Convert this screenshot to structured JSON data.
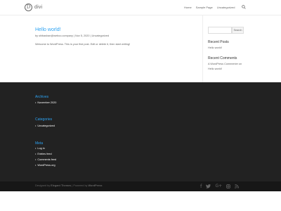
{
  "header": {
    "logo_mark": "D",
    "logo_text": "divi",
    "nav": [
      "Home",
      "Sample Page",
      "Uncategorized"
    ]
  },
  "post": {
    "title": "Hello world!",
    "meta_by": "by",
    "author": "shibashan@weboo.company",
    "separator": "|",
    "date": "Nov 5, 2020",
    "category": "Uncategorized",
    "body": "Welcome to WordPress. This is your first post. Edit or delete it, then start writing!"
  },
  "sidebar": {
    "search_button": "Search",
    "recent_posts_title": "Recent Posts",
    "recent_posts": [
      "Hello world!"
    ],
    "recent_comments_title": "Recent Comments",
    "recent_comment_line1": "A WordPress Commenter on",
    "recent_comment_line2": "Hello world!"
  },
  "footer": {
    "archives_title": "Archives",
    "archives": [
      "November 2020"
    ],
    "categories_title": "Categories",
    "categories": [
      "Uncategorized"
    ],
    "meta_title": "Meta",
    "meta": [
      "Log in",
      "Entries feed",
      "Comments feed",
      "WordPress.org"
    ]
  },
  "bottom": {
    "designed_by": "Designed by",
    "theme_name": "Elegant Themes",
    "powered_by": "| Powered by",
    "powered_name": "WordPress",
    "social_icons": [
      "facebook-icon",
      "twitter-icon",
      "google-plus-icon",
      "instagram-icon",
      "rss-icon"
    ]
  },
  "colors": {
    "accent": "#2ea3f2",
    "footer_bg": "#222222",
    "bottom_bg": "#171717"
  }
}
